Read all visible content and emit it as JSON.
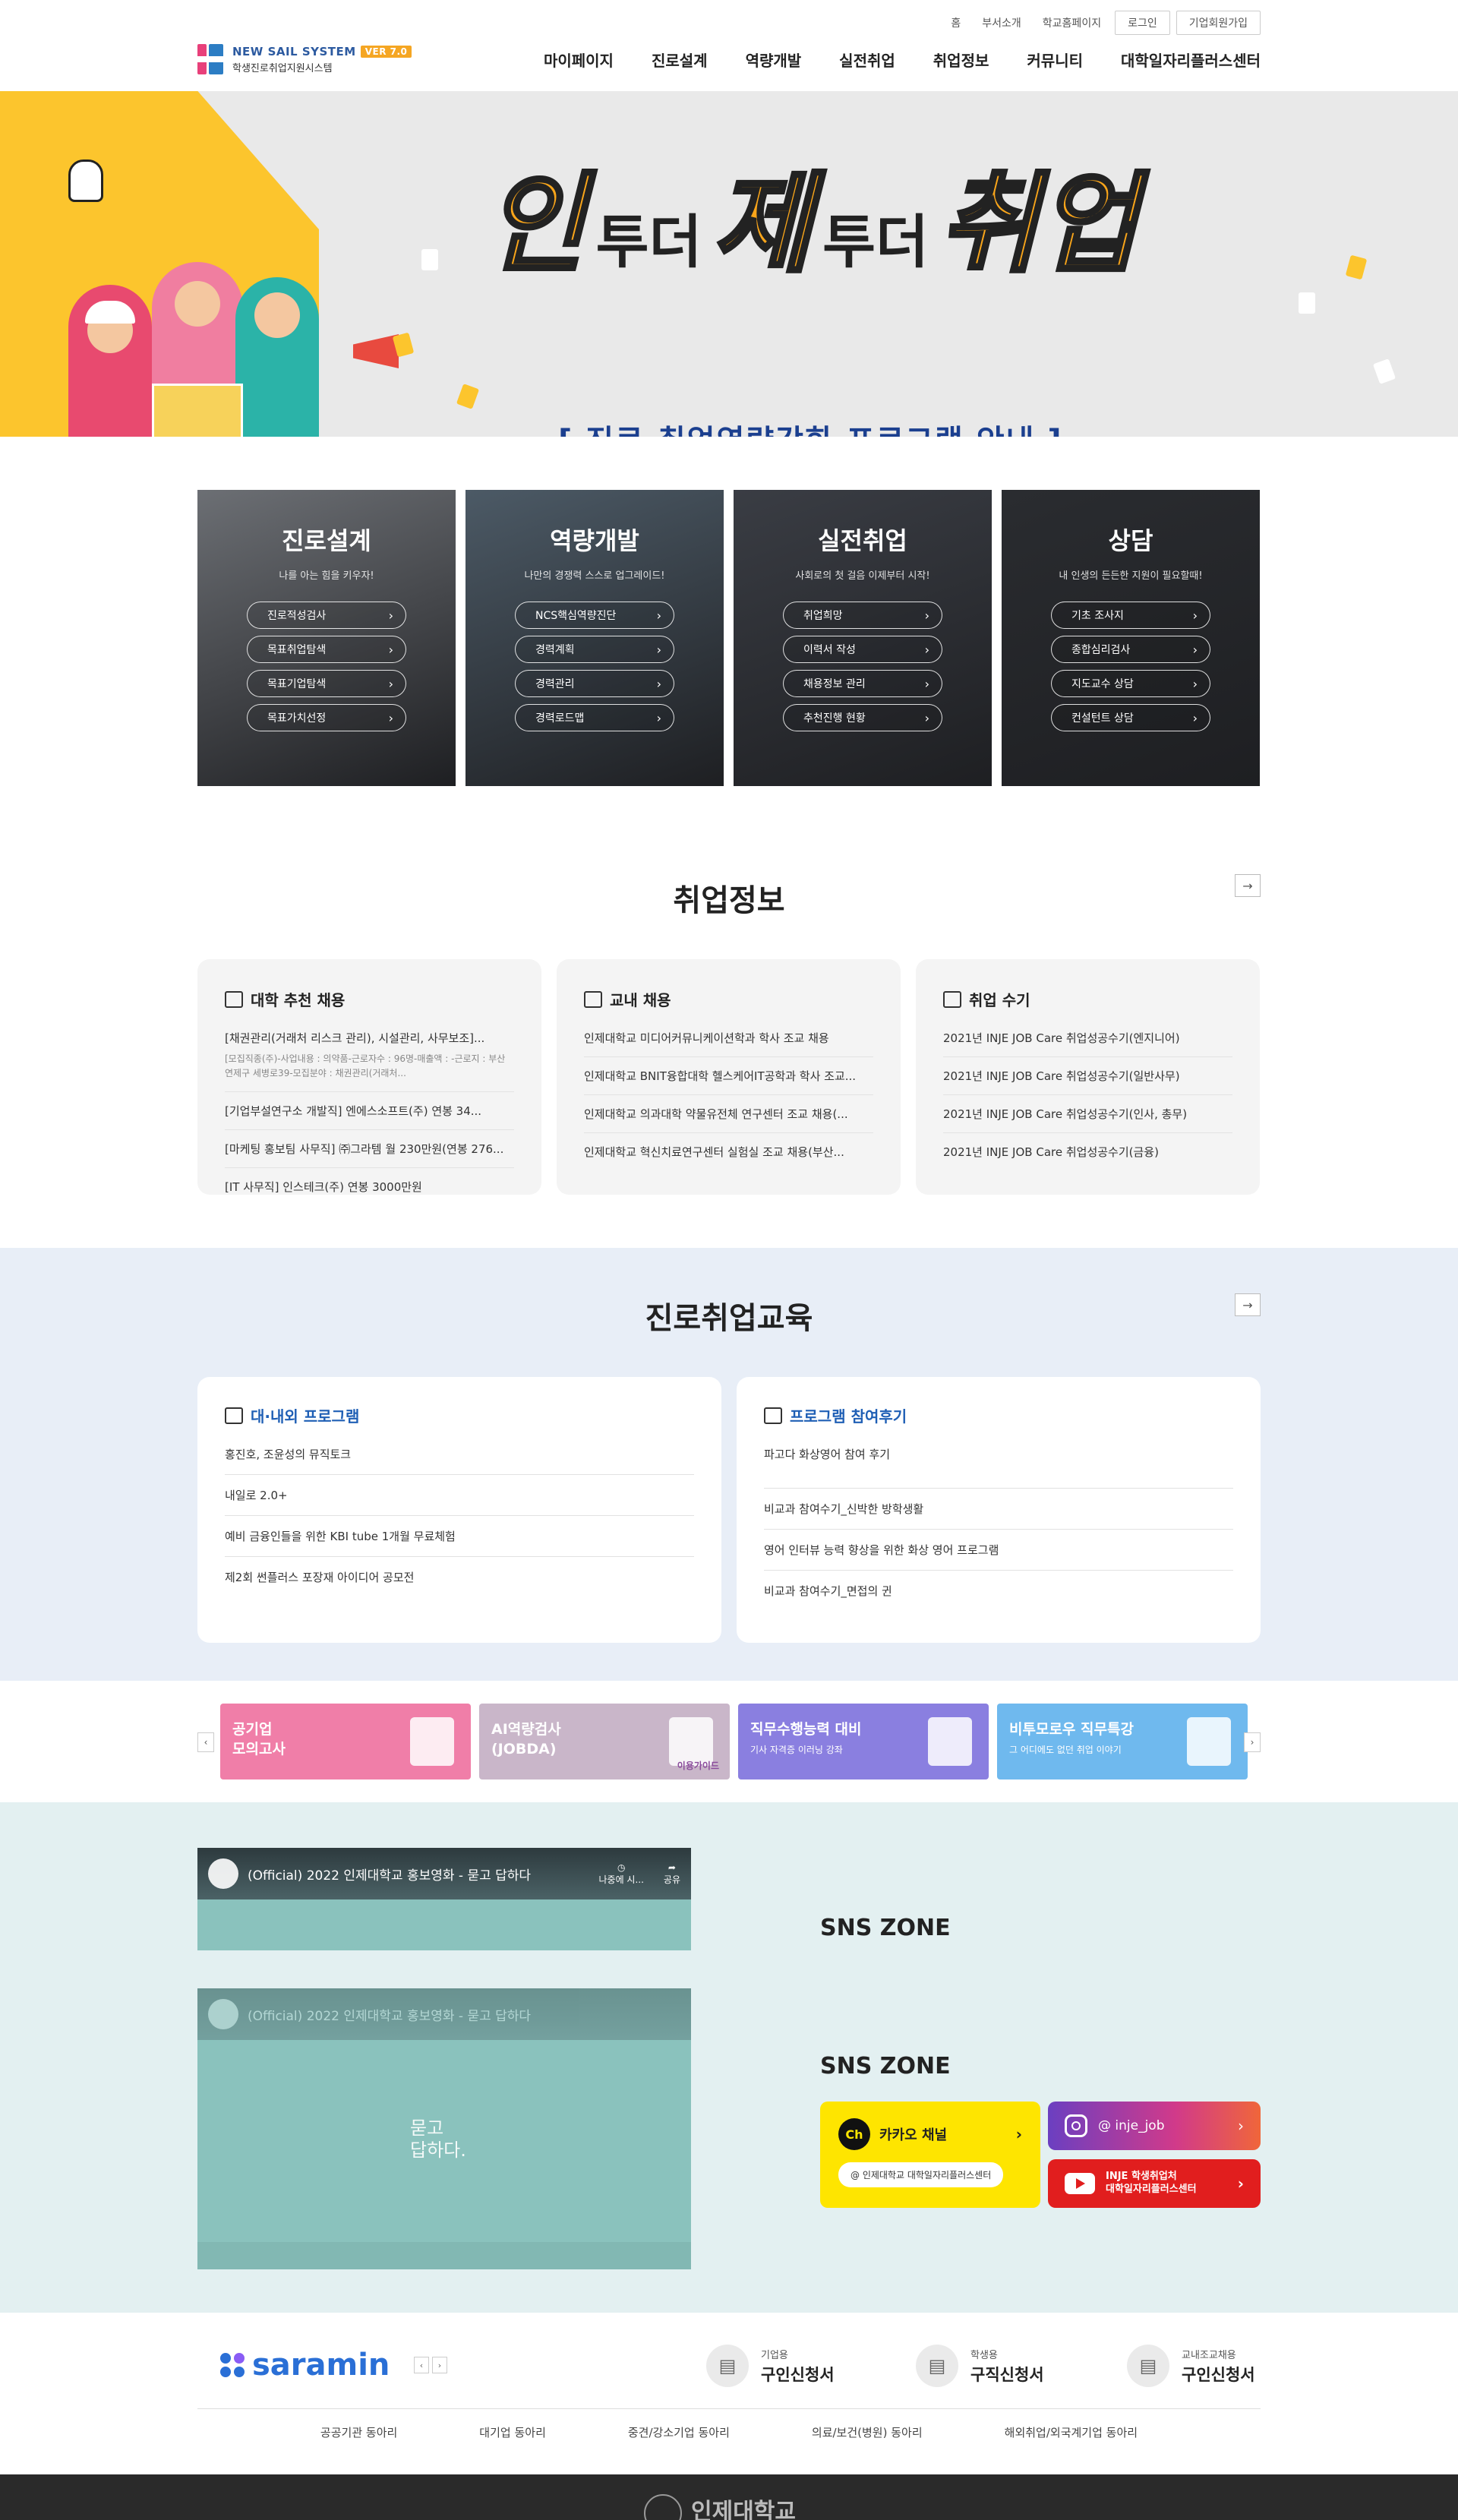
{
  "header": {
    "util_links": [
      "홈",
      "부서소개",
      "학교홈페이지"
    ],
    "login": "로그인",
    "join": "기업회원가입",
    "logo_title": "NEW SAIL SYSTEM",
    "logo_ver": "VER 7.0",
    "logo_sub": "학생진로취업지원시스템",
    "nav": [
      "마이페이지",
      "진로설계",
      "역량개발",
      "실전취업",
      "취업정보",
      "커뮤니티",
      "대학일자리플러스센터"
    ]
  },
  "hero": {
    "big1": "인",
    "mid1": "투더",
    "big2": "제",
    "mid2": "투더",
    "big3": "취업",
    "subtitle": "[ 진로·취업역량강화 프로그램 안내 ]",
    "slides": 5,
    "active_slide": 1
  },
  "quick": [
    {
      "title": "진로설계",
      "desc": "나를 아는 힘을 키우자!",
      "items": [
        "진로적성검사",
        "목표취업탐색",
        "목표기업탐색",
        "목표가치선정"
      ],
      "bg": "#6c6f74"
    },
    {
      "title": "역량개발",
      "desc": "나만의 경쟁력 스스로 업그레이드!",
      "items": [
        "NCS핵심역량진단",
        "경력계획",
        "경력관리",
        "경력로드맵"
      ],
      "bg": "#4c5a66"
    },
    {
      "title": "실전취업",
      "desc": "사회로의 첫 걸음 이제부터 시작!",
      "items": [
        "취업희망",
        "이력서 작성",
        "채용정보 관리",
        "추천진행 현황"
      ],
      "bg": "#3a3d44"
    },
    {
      "title": "상담",
      "desc": "내 인생의 든든한 지원이 필요할때!",
      "items": [
        "기초 조사지",
        "종합심리검사",
        "지도교수 상담",
        "컨설턴트 상담"
      ],
      "bg": "#2a2c30"
    }
  ],
  "jobinfo": {
    "title": "취업정보",
    "more": "→",
    "cards": [
      {
        "title": "대학 추천 채용",
        "items": [
          {
            "text": "[채권관리(거래처 리스크 관리), 시설관리, 사무보조]...",
            "detail": "[모집직종(주)-사업내용 : 의약품-근로자수 : 96명-매출액 : -근로지 : 부산 연제구 세병로39-모집분야 : 채권관리(거래처..."
          },
          {
            "text": "[기업부설연구소 개발직] 엔에스소프트(주) 연봉 34..."
          },
          {
            "text": "[마케팅 홍보팀 사무직] ㈜그라템 월 230만원(연봉 276..."
          },
          {
            "text": "[IT 사무직] 인스테크(주) 연봉 3000만원"
          }
        ]
      },
      {
        "title": "교내 채용",
        "items": [
          {
            "text": "인제대학교 미디어커뮤니케이션학과 학사 조교 채용"
          },
          {
            "text": "인제대학교 BNIT융합대학 헬스케어IT공학과 학사 조교..."
          },
          {
            "text": "인제대학교 의과대학 약물유전체 연구센터 조교 채용(..."
          },
          {
            "text": "인제대학교 혁신치료연구센터 실험실 조교 채용(부산..."
          }
        ]
      },
      {
        "title": "취업 수기",
        "items": [
          {
            "text": "2021년 INJE JOB Care 취업성공수기(엔지니어)"
          },
          {
            "text": "2021년 INJE JOB Care 취업성공수기(일반사무)"
          },
          {
            "text": "2021년 INJE JOB Care 취업성공수기(인사, 총무)"
          },
          {
            "text": "2021년 INJE JOB Care 취업성공수기(금융)"
          }
        ]
      }
    ]
  },
  "edu": {
    "title": "진로취업교육",
    "more": "→",
    "cards": [
      {
        "title": "대·내외 프로그램",
        "items": [
          "홍진호, 조윤성의 뮤직토크",
          "내일로 2.0+",
          "예비 금융인들을 위한 KBI tube 1개월 무료체험",
          "제2회 썬플러스 포장재 아이디어 공모전"
        ]
      },
      {
        "title": "프로그램 참여후기",
        "items": [
          "파고다 화상영어 참여 후기",
          "비교과 참여수기_신박한 방학생활",
          "영어 인터뷰 능력 향상을 위한 화상 영어 프로그램",
          "비교과 참여수기_면접의 귄"
        ]
      }
    ]
  },
  "banners": [
    {
      "title": "공기업\n모의고사",
      "sub": "",
      "bg": "#f07ea8"
    },
    {
      "title": "AI역량검사\n(JOBDA)",
      "sub": "",
      "guide": "이용가이드",
      "bg": "#c9b6c9"
    },
    {
      "title": "직무수행능력 대비",
      "sub": "기사 자격증 이러닝 강좌",
      "bg": "#8a7fe0"
    },
    {
      "title": "비투모로우 직무특강",
      "sub": "그 어디에도 없던 취업 이야기",
      "bg": "#6fb9ee"
    }
  ],
  "sns": {
    "video_title": "(Official) 2022 인제대학교 홍보영화 - 묻고 답하다",
    "video_later": "나중에 시...",
    "video_share": "공유",
    "video_center": "묻고\n답하다.",
    "title1": "SNS ZONE",
    "title2": "SNS ZONE",
    "kakao_ch": "Ch",
    "kakao_label": "카카오 채널",
    "kakao_sub": "@ 인제대학교 대학일자리플러스센터",
    "insta_label": "@ inje_job",
    "youtube_label": "INJE 학생취업처\n대학일자리플러스센터"
  },
  "saramin": {
    "logo": "saramin",
    "requests": [
      {
        "small": "기업용",
        "big": "구인신청서"
      },
      {
        "small": "학생용",
        "big": "구직신청서"
      },
      {
        "small": "교내조교채용",
        "big": "구인신청서"
      }
    ],
    "categories": [
      "공공기관 동아리",
      "대기업 동아리",
      "중견/강소기업 동아리",
      "의료/보건(병원) 동아리",
      "해외취업/외국계기업 동아리"
    ]
  },
  "footer": {
    "name": "인제대학교"
  }
}
